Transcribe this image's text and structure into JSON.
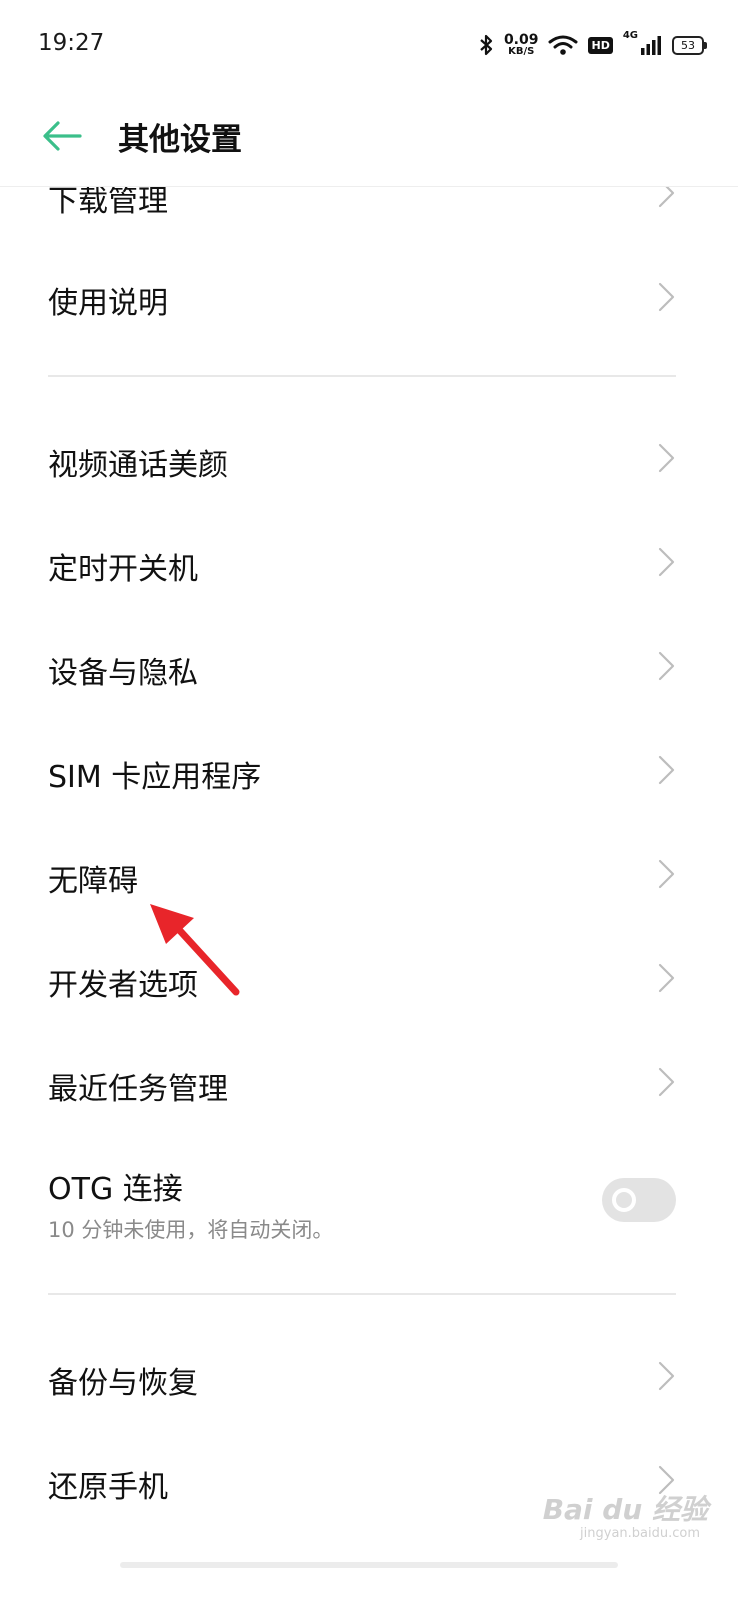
{
  "status_bar": {
    "time": "19:27",
    "net_speed_value": "0.09",
    "net_speed_unit": "KB/S",
    "hd_label": "HD",
    "signal_label": "4G",
    "battery": "53"
  },
  "header": {
    "title": "其他设置",
    "accent_color": "#3bbf8a"
  },
  "items": {
    "download": {
      "label": "下载管理"
    },
    "manual": {
      "label": "使用说明"
    },
    "beauty": {
      "label": "视频通话美颜"
    },
    "schedule_power": {
      "label": "定时开关机"
    },
    "device_privacy": {
      "label": "设备与隐私"
    },
    "sim_apps": {
      "label": "SIM 卡应用程序"
    },
    "accessibility": {
      "label": "无障碍"
    },
    "developer": {
      "label": "开发者选项"
    },
    "recent_tasks": {
      "label": "最近任务管理"
    },
    "otg": {
      "label": "OTG 连接",
      "sub": "10 分钟未使用，将自动关闭。",
      "enabled": false
    },
    "backup": {
      "label": "备份与恢复"
    },
    "reset": {
      "label": "还原手机"
    }
  },
  "annotation": {
    "arrow_color": "#e8252a",
    "points_to": "无障碍"
  },
  "watermark": {
    "brand": "Bai du 经验",
    "url": "jingyan.baidu.com"
  }
}
